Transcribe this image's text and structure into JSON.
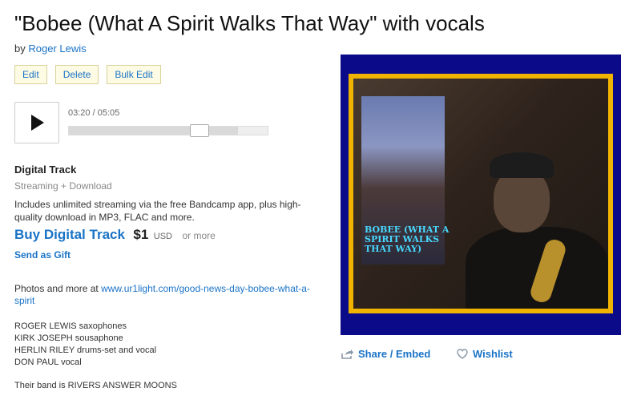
{
  "track": {
    "title": "\"Bobee (What A Spirit Walks That Way\" with vocals",
    "by_prefix": "by",
    "artist": "Roger Lewis"
  },
  "admin": {
    "edit": "Edit",
    "delete": "Delete",
    "bulk_edit": "Bulk Edit"
  },
  "player": {
    "time": "03:20 / 05:05",
    "progress_fraction": 0.655,
    "buffered_fraction": 0.85
  },
  "digital": {
    "title": "Digital Track",
    "subtitle": "Streaming + Download",
    "description": "Includes unlimited streaming via the free Bandcamp app, plus high-quality download in MP3, FLAC and more.",
    "buy_label": "Buy Digital Track",
    "price": "$1",
    "currency": "USD",
    "or_more": "or more",
    "gift": "Send as Gift"
  },
  "about": {
    "prefix": "Photos and more at ",
    "link": "www.ur1light.com/good-news-day-bobee-what-a-spirit"
  },
  "credits": [
    "ROGER LEWIS saxophones",
    "KIRK JOSEPH sousaphone",
    "HERLIN RILEY drums-set and vocal",
    "DON PAUL vocal"
  ],
  "band_line": "Their band is RIVERS ANSWER MOONS",
  "art": {
    "inset_text": "BOBEE (WHAT A SPIRIT WALKS THAT WAY)"
  },
  "actions": {
    "share": "Share / Embed",
    "wishlist": "Wishlist"
  },
  "colors": {
    "link": "#1a73c7",
    "art_border": "#0b0b8a",
    "art_frame": "#f0b400",
    "inset_text": "#48d8ff"
  },
  "icons": {
    "play": "play-icon",
    "share": "share-icon",
    "wishlist": "heart-icon"
  }
}
